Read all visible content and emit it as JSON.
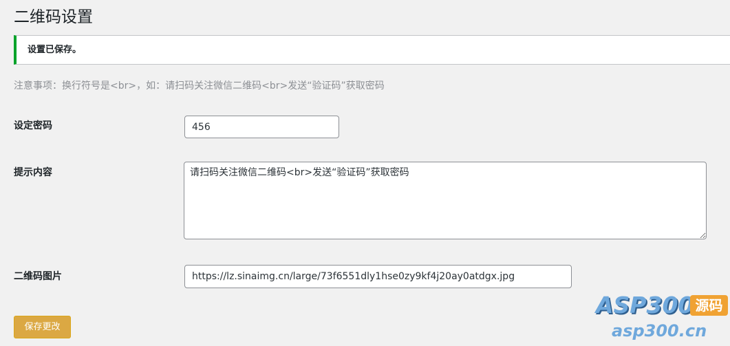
{
  "page": {
    "title": "二维码设置"
  },
  "notice": {
    "text": "设置已保存。",
    "accent_color": "#00a32a"
  },
  "note": "注意事项：换行符号是<br>，如：请扫码关注微信二维码<br>发送“验证码”获取密码",
  "form": {
    "password": {
      "label": "设定密码",
      "value": "456"
    },
    "tip": {
      "label": "提示内容",
      "value": "请扫码关注微信二维码<br>发送“验证码”获取密码"
    },
    "image": {
      "label": "二维码图片",
      "value": "https://lz.sinaimg.cn/large/73f6551dly1hse0zy9kf4j20ay0atdgx.jpg"
    }
  },
  "actions": {
    "save_label": "保存更改",
    "save_color": "#dba843"
  },
  "watermark": {
    "logo": "ASP300",
    "badge": "源码",
    "domain": "asp300.cn"
  }
}
